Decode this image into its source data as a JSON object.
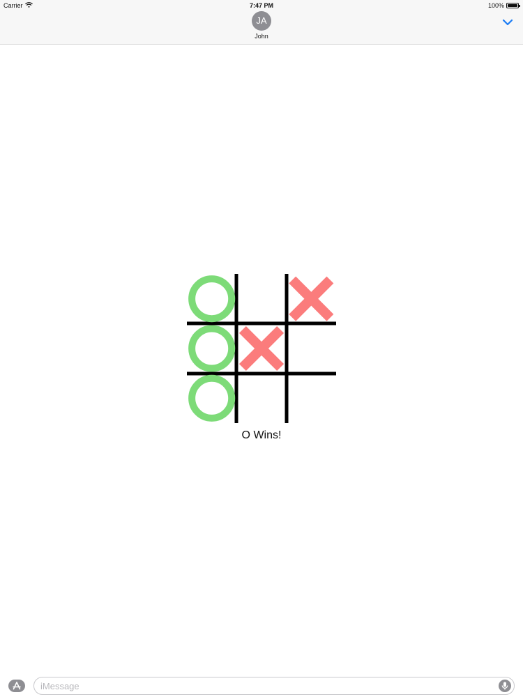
{
  "status_bar": {
    "carrier": "Carrier",
    "time": "7:47 PM",
    "battery": "100%",
    "battery_level": 1.0
  },
  "header": {
    "avatar_initials": "JA",
    "contact_name": "John"
  },
  "game": {
    "board": [
      [
        "O",
        "",
        "X"
      ],
      [
        "O",
        "X",
        ""
      ],
      [
        "O",
        "",
        ""
      ]
    ],
    "result_text": "O Wins!",
    "colors": {
      "o": "#7ddb78",
      "x": "#fb7c7c",
      "grid": "#000000"
    }
  },
  "composer": {
    "placeholder": "iMessage",
    "value": ""
  },
  "icons": {
    "status": [
      "wifi-icon",
      "battery-icon"
    ],
    "header": [
      "chevron-down-icon"
    ],
    "composer": [
      "app-store-icon",
      "microphone-icon"
    ]
  }
}
